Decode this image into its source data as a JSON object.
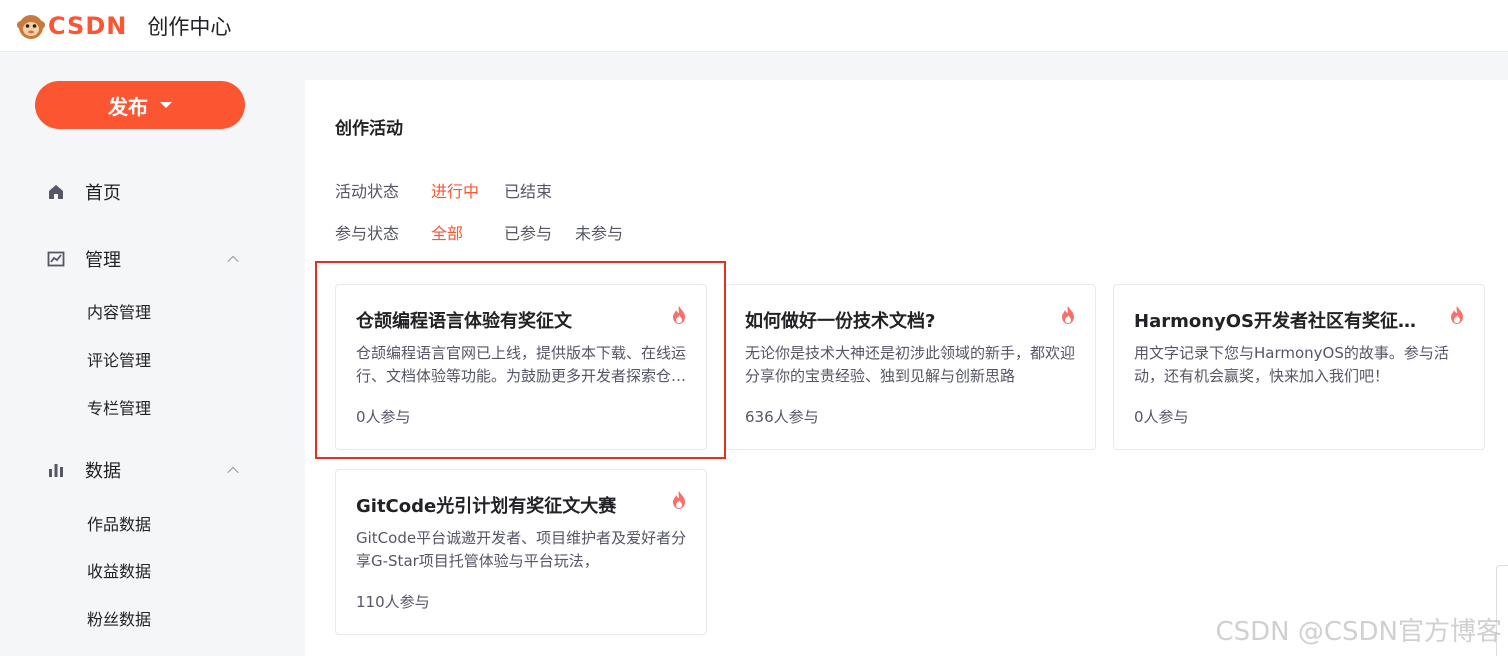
{
  "header": {
    "logo_brand": "CSDN",
    "title": "创作中心"
  },
  "sidebar": {
    "publish_label": "发布",
    "items": [
      {
        "label": "首页",
        "icon": "home-icon"
      },
      {
        "label": "管理",
        "icon": "chart-line-icon",
        "expanded": true,
        "children": [
          "内容管理",
          "评论管理",
          "专栏管理"
        ]
      },
      {
        "label": "数据",
        "icon": "bar-chart-icon",
        "expanded": true,
        "children": [
          "作品数据",
          "收益数据",
          "粉丝数据"
        ]
      }
    ]
  },
  "main": {
    "section_title": "创作活动",
    "filters": {
      "activity_status": {
        "label": "活动状态",
        "options": [
          "进行中",
          "已结束"
        ],
        "selected": "进行中"
      },
      "participation_status": {
        "label": "参与状态",
        "options": [
          "全部",
          "已参与",
          "未参与"
        ],
        "selected": "全部"
      }
    },
    "cards": [
      {
        "title": "仓颉编程语言体验有奖征文",
        "desc": "仓颉编程语言官网已上线，提供版本下载、在线运行、文档体验等功能。为鼓励更多开发者探索仓颉编程语言",
        "count": "0人参与"
      },
      {
        "title": "如何做好一份技术文档?",
        "desc": "无论你是技术大神还是初涉此领域的新手，都欢迎分享你的宝贵经验、独到见解与创新思路",
        "count": "636人参与"
      },
      {
        "title": "HarmonyOS开发者社区有奖征文来啦",
        "desc": "用文字记录下您与HarmonyOS的故事。参与活动，还有机会赢奖，快来加入我们吧！",
        "count": "0人参与"
      },
      {
        "title": "GitCode光引计划有奖征文大赛",
        "desc": "GitCode平台诚邀开发者、项目维护者及爱好者分享G-Star项目托管体验与平台玩法，",
        "count": "110人参与"
      }
    ]
  },
  "watermark": "CSDN @CSDN官方博客",
  "colors": {
    "accent": "#fc5531",
    "highlight": "#e4301c",
    "fire": "#f7706a"
  }
}
